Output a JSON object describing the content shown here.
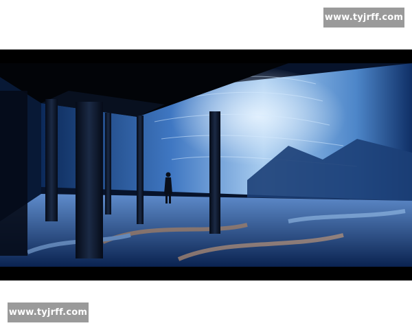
{
  "watermark_top": {
    "text": "www.tyjrff.com"
  },
  "watermark_bottom": {
    "text": "www.tyjrff.com"
  },
  "colors": {
    "page_bg": "#ffffff",
    "letterbox": "#000000",
    "watermark_bg": "#9a9a9a",
    "watermark_text": "#ffffff"
  }
}
